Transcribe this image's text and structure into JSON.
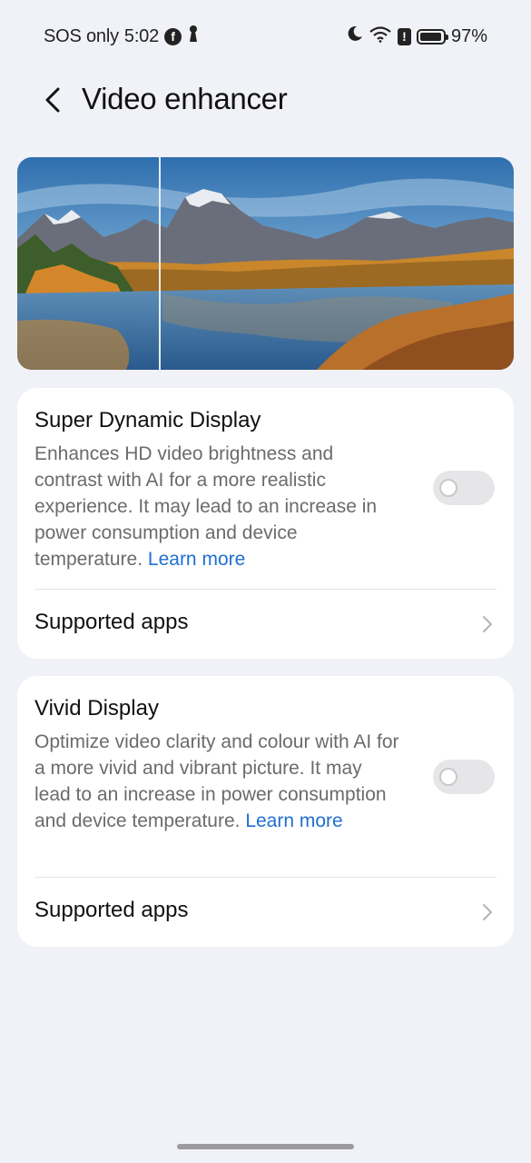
{
  "status_bar": {
    "carrier": "SOS only",
    "time": "5:02",
    "battery": "97%"
  },
  "header": {
    "title": "Video enhancer"
  },
  "super_dynamic": {
    "title": "Super Dynamic Display",
    "description": "Enhances HD video brightness and contrast with AI for a more realistic experience. It may lead to an increase in power consumption and device temperature.",
    "learn_more": "Learn more",
    "enabled": false,
    "supported_apps": "Supported apps"
  },
  "vivid": {
    "title": "Vivid Display",
    "description": "Optimize video clarity and colour with AI for a more vivid and vibrant picture. It may lead to an increase in power consumption and device temperature.",
    "learn_more": "Learn more",
    "enabled": false,
    "supported_apps": "Supported apps"
  },
  "colors": {
    "background": "#f1f2f7",
    "card": "#ffffff",
    "link": "#1f6fd1",
    "toggle_off": "#e6e6e9"
  }
}
